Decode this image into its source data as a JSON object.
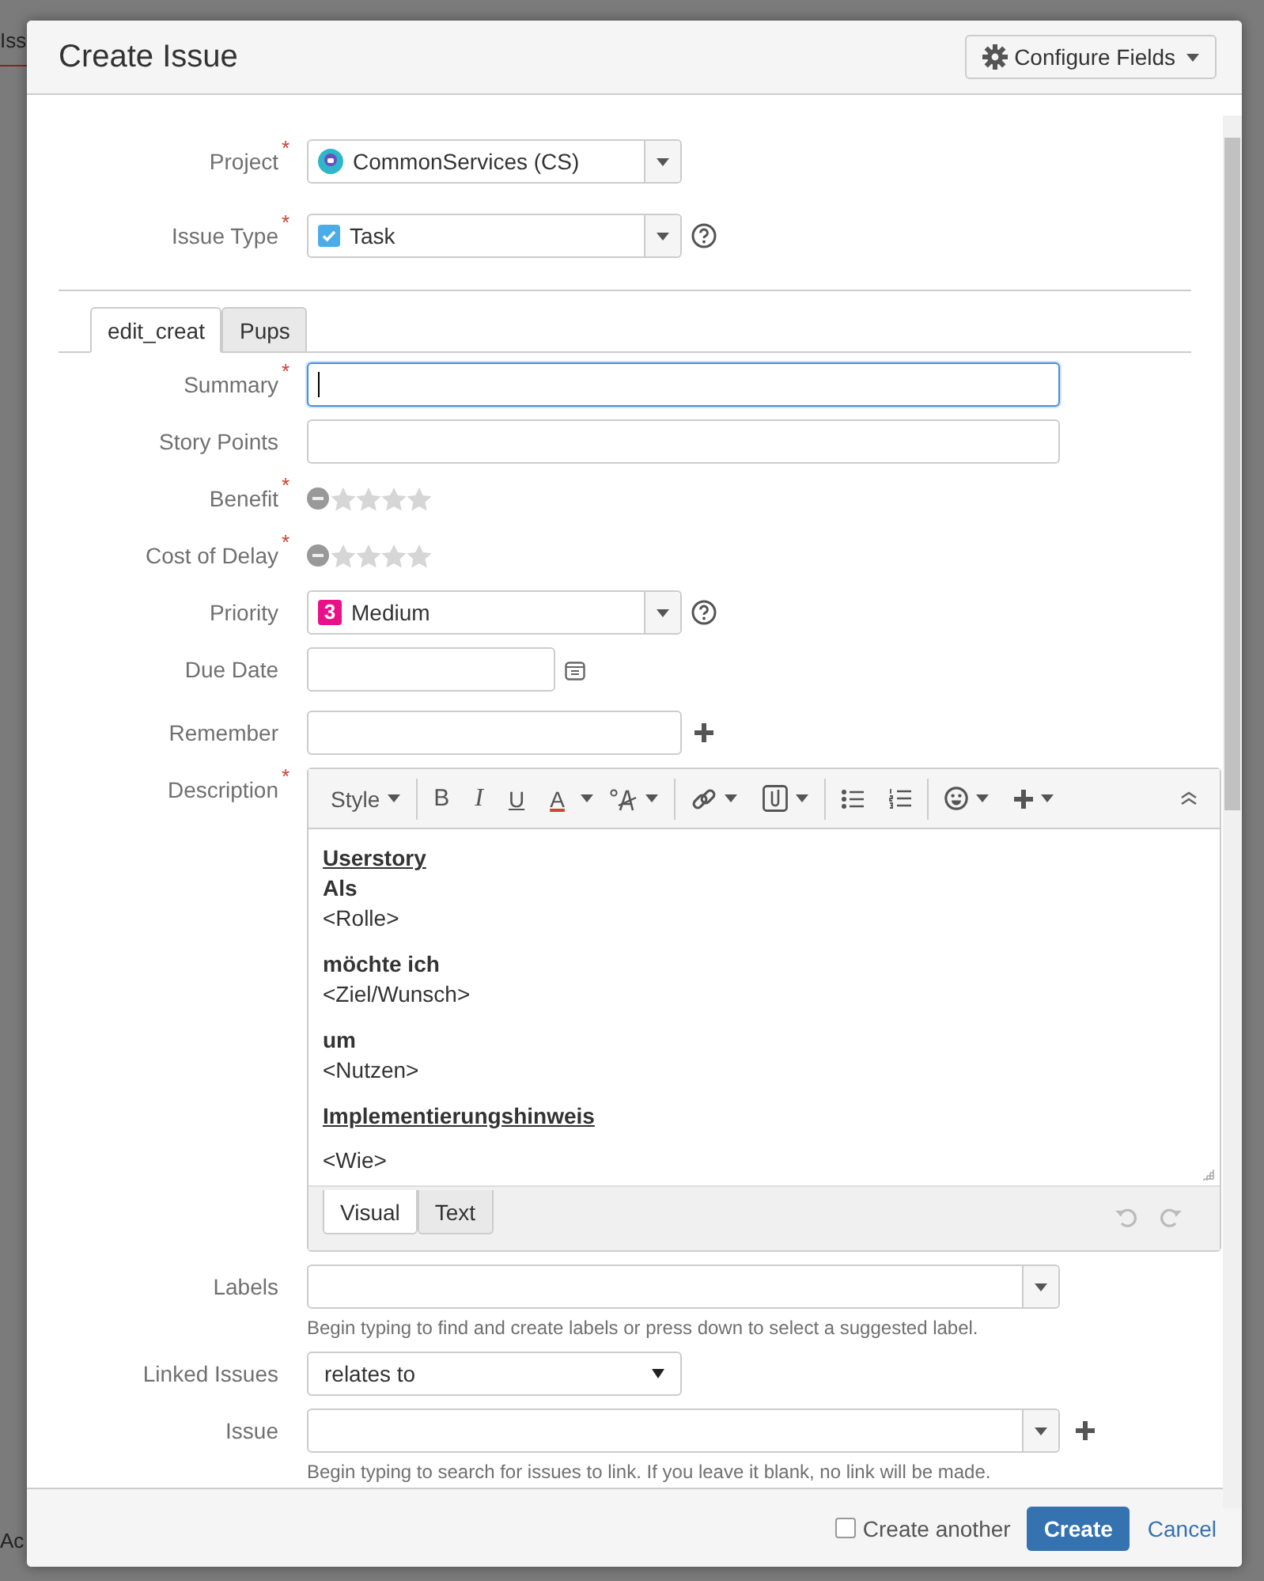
{
  "background": {
    "fragments": [
      "Iss",
      "Ac"
    ]
  },
  "dialog": {
    "title": "Create Issue",
    "configure_button": "Configure Fields"
  },
  "header_fields": [
    {
      "label": "Project",
      "marker": "*",
      "kind": "select",
      "value": "CommonServices (CS)",
      "help": false
    },
    {
      "label": "Issue Type",
      "marker": "*",
      "kind": "select",
      "value": "Task",
      "help": true
    }
  ],
  "tabs": [
    {
      "label": "edit_creat",
      "selected": true
    },
    {
      "label": "Pups",
      "selected": false
    }
  ],
  "fields": [
    {
      "label": "Summary",
      "marker": "*",
      "kind": "text",
      "focused": true
    },
    {
      "label": "Story Points",
      "kind": "text",
      "focused": false
    },
    {
      "label": "Benefit",
      "marker": "*",
      "kind": "rating",
      "stars": 0
    },
    {
      "label": "Cost of Delay",
      "marker": "*",
      "kind": "rating",
      "stars": 0
    },
    {
      "label": "Priority",
      "kind": "select",
      "badge": "3",
      "value": "Medium",
      "help": true
    },
    {
      "label": "Due Date",
      "kind": "date"
    },
    {
      "label": "Remember",
      "kind": "text_add"
    },
    {
      "label": "Description",
      "marker": "*",
      "kind": "editor",
      "toolbar_labels": [
        "Style",
        "B",
        "I",
        "U",
        "A"
      ],
      "paragraphs": [
        [
          {
            "kind": "heading",
            "text": "Userstory"
          },
          {
            "kind": "bold",
            "text": "Als"
          },
          {
            "kind": "plain",
            "text": "<Rolle>"
          }
        ],
        [
          {
            "kind": "bold",
            "text": "möchte ich"
          },
          {
            "kind": "plain",
            "text": "<Ziel/Wunsch>"
          }
        ],
        [
          {
            "kind": "bold",
            "text": "um"
          },
          {
            "kind": "plain",
            "text": "<Nutzen>"
          }
        ],
        [
          {
            "kind": "heading",
            "text": "Implementierungshinweis"
          }
        ],
        [
          {
            "kind": "plain",
            "text": "<Wie>"
          }
        ]
      ],
      "mode_tabs": [
        {
          "label": "Visual",
          "selected": true
        },
        {
          "label": "Text",
          "selected": false
        }
      ]
    },
    {
      "label": "Labels",
      "kind": "combo",
      "hint": "Begin typing to find and create labels or press down to select a suggested label."
    },
    {
      "label": "Linked Issues",
      "kind": "native_select",
      "value": "relates to"
    },
    {
      "label": "Issue",
      "kind": "combo_add",
      "hint": "Begin typing to search for issues to link. If you leave it blank, no link will be made."
    }
  ],
  "footer": {
    "checkbox": {
      "label": "Create another",
      "checked": false
    },
    "primary": "Create",
    "cancel": "Cancel"
  }
}
